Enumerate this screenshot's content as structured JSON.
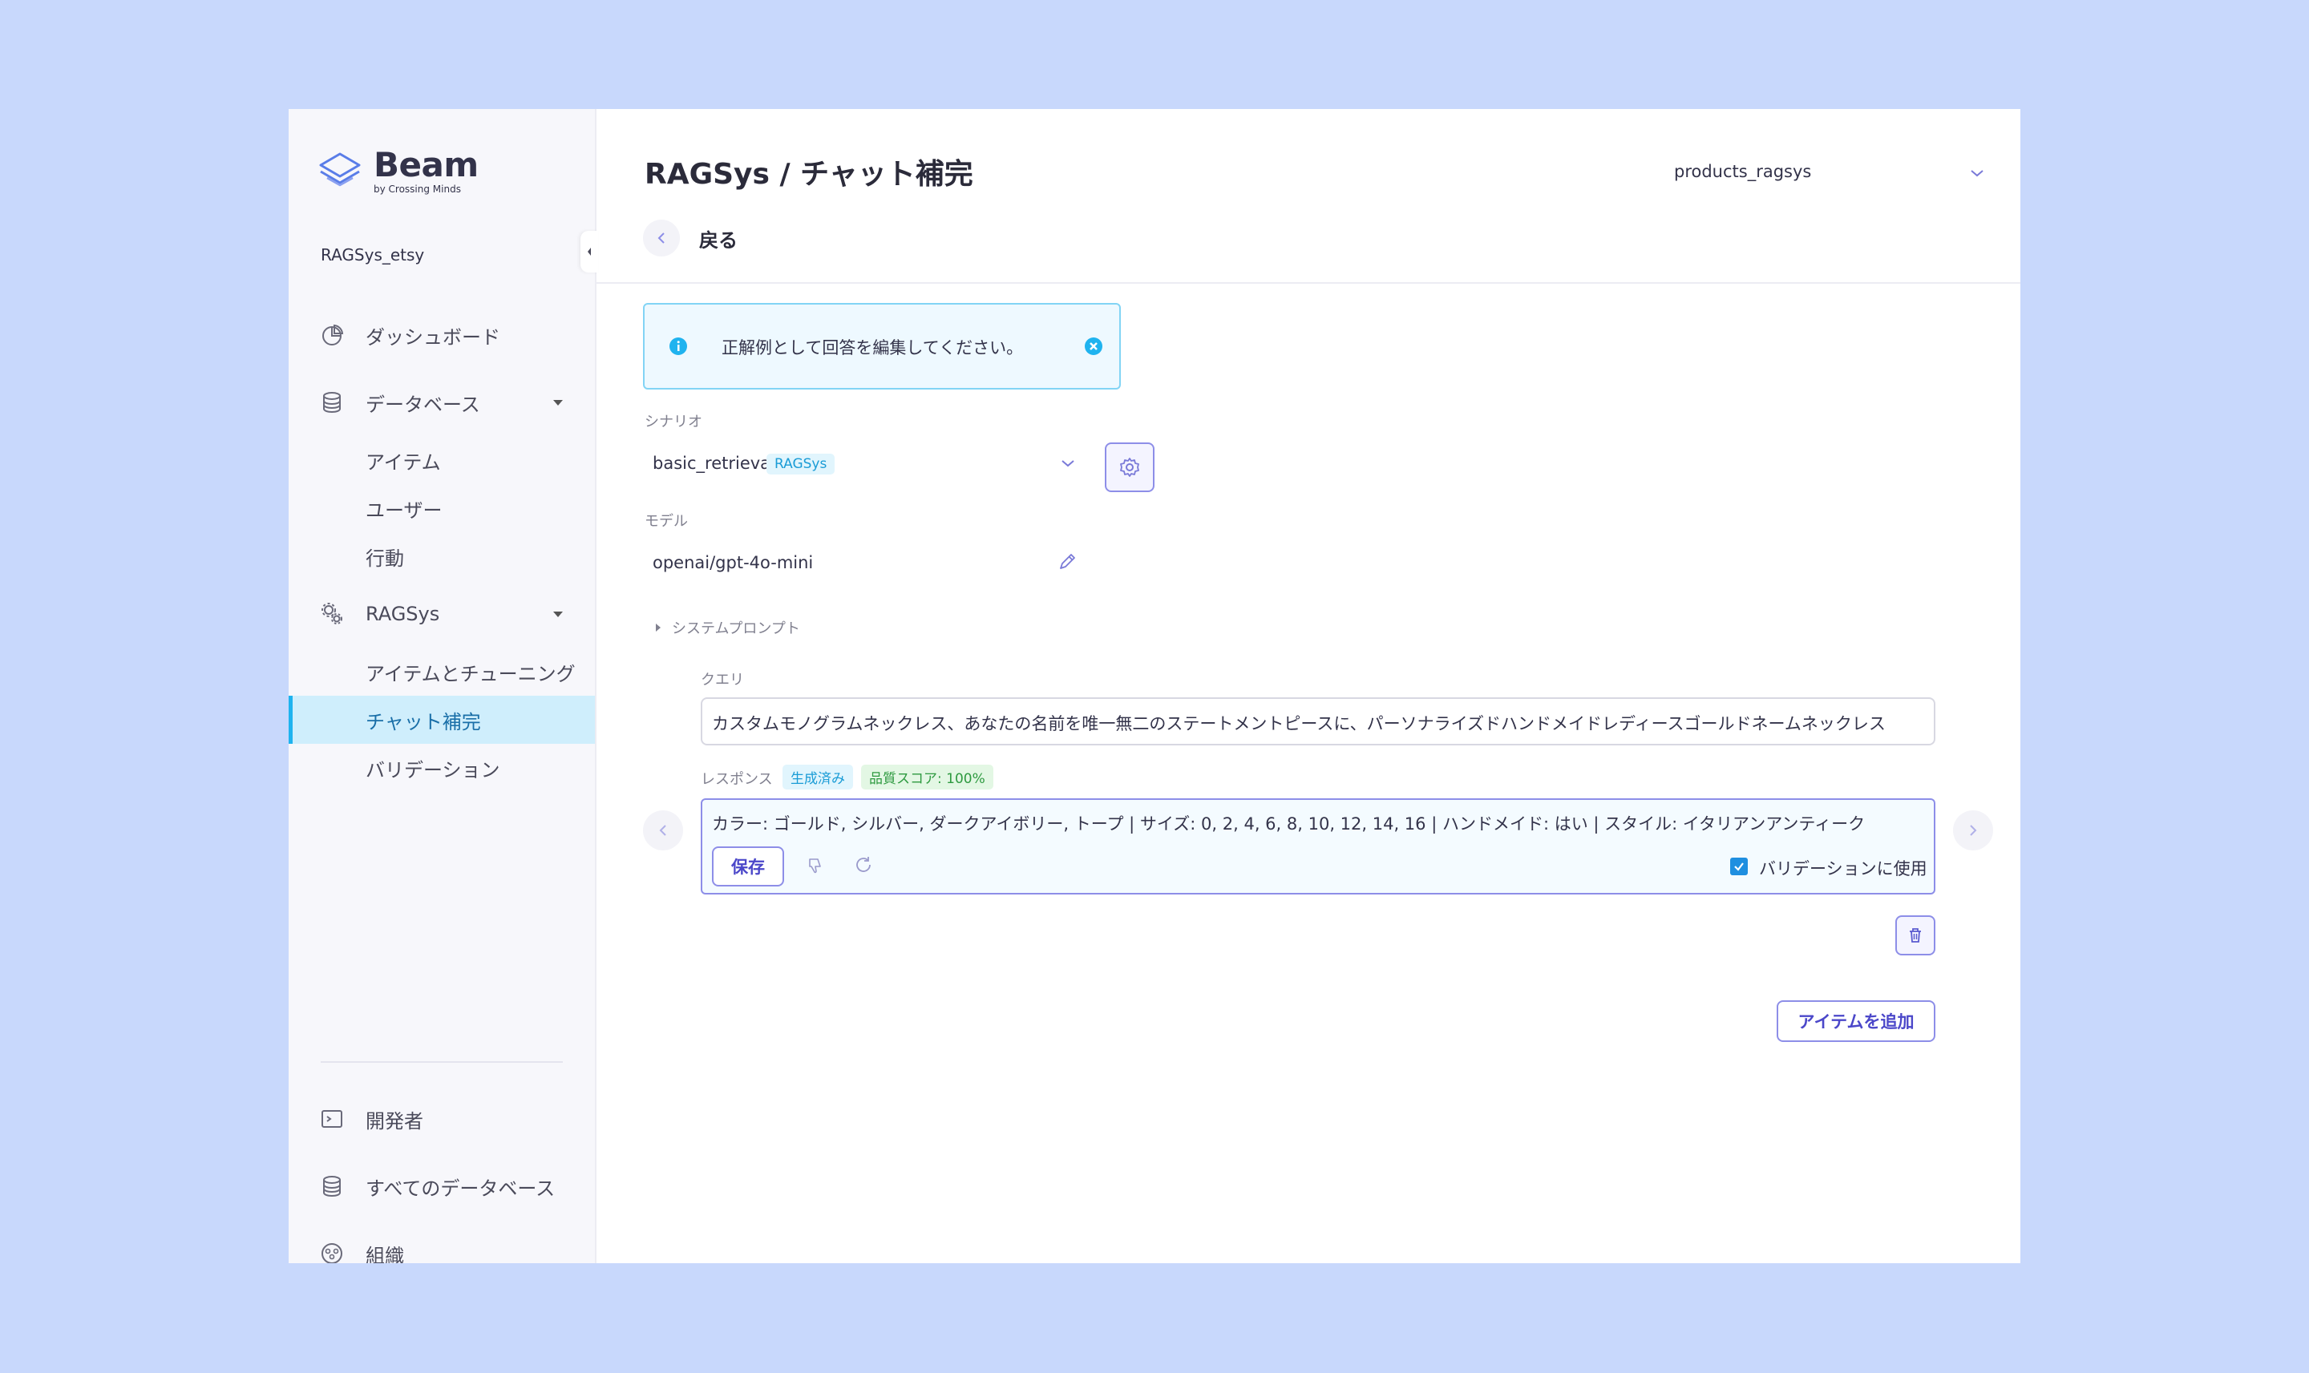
{
  "colors": {
    "background": "#c8d8fc",
    "accent": "#4b47c9",
    "active_nav": "#cfeefc",
    "info": "#1fb3ef",
    "success_badge": "#2e9a40"
  },
  "brand": {
    "name": "Beam",
    "subtitle": "by Crossing Minds"
  },
  "sidebar": {
    "project": "RAGSys_etsy",
    "items": [
      {
        "label": "ダッシュボード",
        "icon": "pie-chart-icon"
      },
      {
        "label": "データベース",
        "icon": "database-icon"
      },
      {
        "label": "アイテム"
      },
      {
        "label": "ユーザー"
      },
      {
        "label": "行動"
      },
      {
        "label": "RAGSys",
        "icon": "gears-icon"
      },
      {
        "label": "アイテムとチューニング"
      },
      {
        "label": "チャット補完"
      },
      {
        "label": "バリデーション"
      }
    ],
    "bottom": [
      {
        "label": "開発者",
        "icon": "terminal-icon"
      },
      {
        "label": "すべてのデータベース",
        "icon": "database-icon"
      },
      {
        "label": "組織",
        "icon": "organization-icon"
      }
    ]
  },
  "header": {
    "title": "RAGSys / チャット補完",
    "database_select": "products_ragsys",
    "back_label": "戻る"
  },
  "alert": {
    "text": "正解例として回答を編集してください。"
  },
  "form": {
    "scenario_label": "シナリオ",
    "scenario_value": "basic_retrieval",
    "scenario_badge": "RAGSys",
    "model_label": "モデル",
    "model_value": "openai/gpt-4o-mini",
    "system_prompt_label": "システムプロンプト"
  },
  "example": {
    "query_label": "クエリ",
    "query_value": "カスタムモノグラムネックレス、あなたの名前を唯一無二のステートメントピースに、パーソナライズドハンドメイドレディースゴールドネームネックレス",
    "response_label": "レスポンス",
    "generated_badge": "生成済み",
    "quality_badge": "品質スコア: 100%",
    "response_value": "カラー: ゴールド, シルバー, ダークアイボリー, トープ | サイズ: 0, 2, 4, 6, 8, 10, 12, 14, 16 | ハンドメイド: はい | スタイル: イタリアンアンティーク",
    "save_label": "保存",
    "validation_checkbox_label": "バリデーションに使用",
    "validation_checked": true
  },
  "actions": {
    "add_item_label": "アイテムを追加"
  }
}
